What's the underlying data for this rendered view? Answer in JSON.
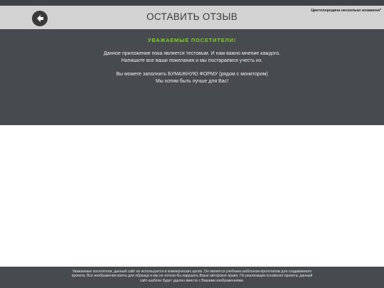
{
  "header": {
    "title": "ОСТАВИТЬ ОТЗЫВ",
    "note": "Цветопередача несколько искажена*",
    "back_icon": "arrow-left-icon"
  },
  "content": {
    "headline": "УВАЖАЕМЫЕ ПОСЕТИТЕЛИ!",
    "paragraph1_line1": "Данное приложение пока является тестовым. И нам важно мнение каждого.",
    "paragraph1_line2": "Напишите все ваши пожелания и мы постараемся учесть их.",
    "paragraph2_line1": "Вы можете заполнить БУМАЖНУЮ ФОРМУ (рядом с монитором)",
    "paragraph2_line2": "Мы хотим быть лучше для Вас!"
  },
  "footer": {
    "line1": "Уважаемые посетители, данный сайт не используется в коммерческих целях. Он является учебным шаблоном-прототипом для создаваемого",
    "line2": "проекта. Все изображения взяты для образца и мы не хотели бы нарушать Ваше авторское право. По реализации основного проекта, данный",
    "line3": "сайт-шаблон будет удален вместе с Вашими изображениями."
  },
  "colors": {
    "dark_panel": "#474a4f",
    "header_bg": "#d2d2d2",
    "accent_green": "#7ed321"
  }
}
